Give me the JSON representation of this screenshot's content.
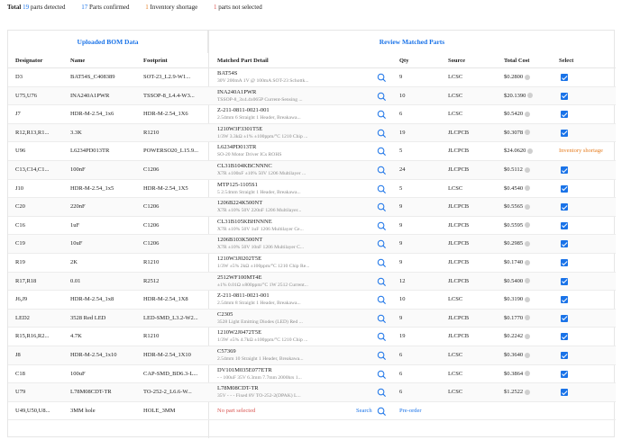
{
  "summary": {
    "total_label": "Total",
    "total_count": "19",
    "total_suffix": "parts detected",
    "confirmed_count": "17",
    "confirmed_suffix": "Parts confirmed",
    "shortage_count": "1",
    "shortage_suffix": "Inventory shortage",
    "not_selected_count": "1",
    "not_selected_suffix": "parts not selected"
  },
  "sections": {
    "uploaded": "Uploaded BOM Data",
    "review": "Review Matched Parts"
  },
  "columns": {
    "designator": "Designator",
    "name": "Name",
    "footprint": "Footprint",
    "matched": "Matched Part Detail",
    "qty": "Qty",
    "source": "Source",
    "total_cost": "Total Cost",
    "select": "Select"
  },
  "rows": [
    {
      "designator": "D3",
      "name": "BAT54S_C408389",
      "footprint": "SOT-23_L2.9-W1...",
      "part": "BAT54S",
      "desc": "30V 200mA 1V @ 100mA SOT-23 Schottk...",
      "qty": "9",
      "source": "LCSC",
      "cost": "$0.2800",
      "select": "checked"
    },
    {
      "designator": "U75,U76",
      "name": "INA240A1PWR",
      "footprint": "TSSOP-8_L4.4-W3...",
      "part": "INA240A1PWR",
      "desc": "TSSOP-8_3x4.4x065P Current-Sensing ...",
      "qty": "10",
      "source": "LCSC",
      "cost": "$20.1390",
      "select": "checked"
    },
    {
      "designator": "J7",
      "name": "HDR-M-2.54_1x6",
      "footprint": "HDR-M-2.54_1X6",
      "part": "Z-211-0811-0021-001",
      "desc": "2.54mm 6 Straight 1 Header,   Breakawa...",
      "qty": "6",
      "source": "LCSC",
      "cost": "$0.5420",
      "select": "checked"
    },
    {
      "designator": "R12,R13,R1...",
      "name": "3.3K",
      "footprint": "R1210",
      "part": "1210W3F3301T5E",
      "desc": "1/3W 3.3kΩ ±1% ±100ppm/°C 1210 Chip ...",
      "qty": "19",
      "source": "JLCPCB",
      "cost": "$0.3078",
      "select": "checked"
    },
    {
      "designator": "U96",
      "name": "L6234PD013TR",
      "footprint": "POWERSO20_L15.9...",
      "part": "L6234PD013TR",
      "desc": "SO-20 Motor Driver ICs ROHS",
      "qty": "5",
      "source": "JLCPCB",
      "cost": "$24.0620",
      "select": "shortage"
    },
    {
      "designator": "C13,C14,C1...",
      "name": "100nF",
      "footprint": "C1206",
      "part": "CL31B104KBCNNNC",
      "desc": "X7R ±100nF ±10% 50V 1206 Multilayer ...",
      "qty": "24",
      "source": "JLCPCB",
      "cost": "$0.5112",
      "select": "checked"
    },
    {
      "designator": "J10",
      "name": "HDR-M-2.54_1x5",
      "footprint": "HDR-M-2.54_1X5",
      "part": "MTP125-1105S1",
      "desc": "5 2.54mm Straight 1 Header,   Breakawa...",
      "qty": "5",
      "source": "LCSC",
      "cost": "$0.4540",
      "select": "checked"
    },
    {
      "designator": "C20",
      "name": "220nF",
      "footprint": "C1206",
      "part": "1206B224K500NT",
      "desc": "X7R ±10% 50V 220nF 1206 Multilayer...",
      "qty": "9",
      "source": "JLCPCB",
      "cost": "$0.5565",
      "select": "checked"
    },
    {
      "designator": "C16",
      "name": "1uF",
      "footprint": "C1206",
      "part": "CL31B105KBHNNNE",
      "desc": "X7R ±10% 50V 1uF 1206 Multilayer Ce...",
      "qty": "9",
      "source": "JLCPCB",
      "cost": "$0.5595",
      "select": "checked"
    },
    {
      "designator": "C19",
      "name": "10uF",
      "footprint": "C1206",
      "part": "1206B103K500NT",
      "desc": "X7R ±10% 50V 10nF 1206 Multilayer C...",
      "qty": "9",
      "source": "JLCPCB",
      "cost": "$0.2985",
      "select": "checked"
    },
    {
      "designator": "R19",
      "name": "2K",
      "footprint": "R1210",
      "part": "1210W3J0202T5E",
      "desc": "1/3W ±5% 2kΩ ±100ppm/°C 1210 Chip Re...",
      "qty": "9",
      "source": "JLCPCB",
      "cost": "$0.1740",
      "select": "checked"
    },
    {
      "designator": "R17,R18",
      "name": "0.01",
      "footprint": "R2512",
      "part": "2512WF100MT4E",
      "desc": "±1% 0.01Ω ±800ppm/°C 1W 2512 Current...",
      "qty": "12",
      "source": "JLCPCB",
      "cost": "$0.5400",
      "select": "checked"
    },
    {
      "designator": "J6,J9",
      "name": "HDR-M-2.54_1x8",
      "footprint": "HDR-M-2.54_1X8",
      "part": "Z-211-0811-0021-001",
      "desc": "2.54mm 8 Straight 1 Header,   Breakawa...",
      "qty": "10",
      "source": "LCSC",
      "cost": "$0.3190",
      "select": "checked"
    },
    {
      "designator": "LED2",
      "name": "3528 Red LED",
      "footprint": "LED-SMD_L3.2-W2...",
      "part": "C2305",
      "desc": "3528 Light Emitting Diodes (LED) Red ...",
      "qty": "9",
      "source": "JLCPCB",
      "cost": "$0.1770",
      "select": "checked"
    },
    {
      "designator": "R15,R16,R2...",
      "name": "4.7K",
      "footprint": "R1210",
      "part": "1210W2J0472T5E",
      "desc": "1/3W ±5% 4.7kΩ ±100ppm/°C 1210 Chip ...",
      "qty": "19",
      "source": "JLCPCB",
      "cost": "$0.2242",
      "select": "checked"
    },
    {
      "designator": "J8",
      "name": "HDR-M-2.54_1x10",
      "footprint": "HDR-M-2.54_1X10",
      "part": "C57369",
      "desc": "2.54mm 10 Straight 1 Header,   Breakawa...",
      "qty": "6",
      "source": "LCSC",
      "cost": "$0.3640",
      "select": "checked"
    },
    {
      "designator": "C18",
      "name": "100uF",
      "footprint": "CAP-SMD_BD6.3-L...",
      "part": "DV101M035E077ETR",
      "desc": "- - 100uF 35V 6.3mm 7.7mm 2000hrs 1...",
      "qty": "6",
      "source": "LCSC",
      "cost": "$0.3864",
      "select": "checked"
    },
    {
      "designator": "U79",
      "name": "L78M08CDT-TR",
      "footprint": "TO-252-2_L6.6-W...",
      "part": "L78M08CDT-TR",
      "desc": "35V - - - Fixed 8V TO-252-2(DPAK) L...",
      "qty": "6",
      "source": "LCSC",
      "cost": "$1.2522",
      "select": "checked"
    },
    {
      "designator": "U49,U50,U8...",
      "name": "3MM hole",
      "footprint": "HOLE_3MM",
      "part": "No part selected",
      "desc": "",
      "qty": "",
      "source": "",
      "cost": "",
      "select": "none",
      "search_label": "Search",
      "preorder_label": "Pre-order"
    }
  ],
  "shortage_label": "Inventory shortage",
  "colors": {
    "accent": "#1a73e8",
    "shortage": "#e67e22",
    "error": "#d9534f"
  }
}
